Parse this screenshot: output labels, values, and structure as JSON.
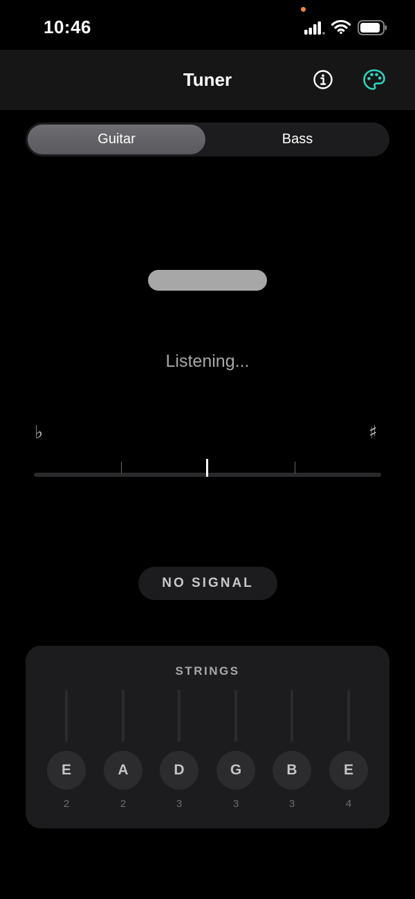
{
  "status_bar": {
    "time": "10:46",
    "recording_dot_color": "#f2883a",
    "icons": [
      "cellular-signal-icon",
      "wifi-icon",
      "battery-icon"
    ]
  },
  "nav": {
    "title": "Tuner",
    "info_icon": "info-icon",
    "palette_icon": "palette-icon",
    "accent_color": "#2dd4bf"
  },
  "segments": {
    "options": [
      "Guitar",
      "Bass"
    ],
    "selected": "Guitar"
  },
  "tuner": {
    "status_text": "Listening...",
    "flat_symbol": "♭",
    "sharp_symbol": "♯",
    "signal_label": "NO SIGNAL"
  },
  "strings": {
    "title": "STRINGS",
    "items": [
      {
        "note": "E",
        "octave": "2"
      },
      {
        "note": "A",
        "octave": "2"
      },
      {
        "note": "D",
        "octave": "3"
      },
      {
        "note": "G",
        "octave": "3"
      },
      {
        "note": "B",
        "octave": "3"
      },
      {
        "note": "E",
        "octave": "4"
      }
    ]
  }
}
